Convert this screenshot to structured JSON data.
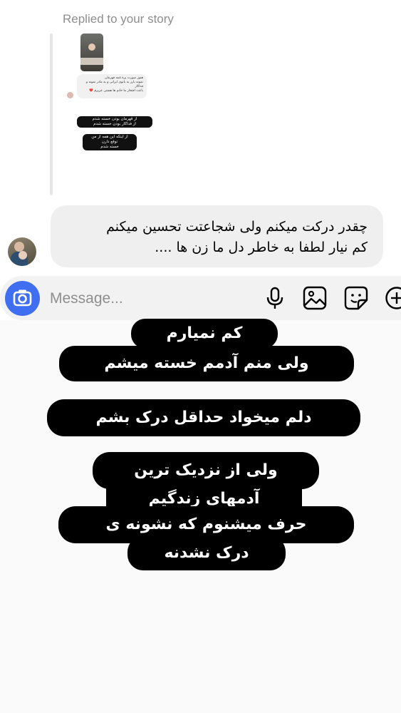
{
  "dm": {
    "replied_label": "Replied to your story",
    "story": {
      "caption_lines": [
        "هنوز صورت پره غمه قهرمان",
        "نمونه بارز به بانوی ایرانی و یه مادر نمونه و فداکار",
        "باعث افتخار ما خانم ها هستی عزیزم ❤️"
      ],
      "mini_pill_1": [
        "از قهرمان بودن خسته شدم",
        "از فداکار بودن خسته شدم"
      ],
      "mini_pill_2": [
        "از اینکه این همه از من",
        "توقع دارن",
        "خسته شدم"
      ]
    },
    "message_lines": [
      "چقدر درکت میکنم ولی شجاعتت تحسین میکنم",
      "کم نیار لطفا به خاطر دل ما زن ها ...."
    ]
  },
  "composer": {
    "placeholder": "Message...",
    "accent_color": "#3f6ff0",
    "icons": [
      "camera-icon",
      "microphone-icon",
      "gallery-icon",
      "sticker-icon",
      "plus-icon"
    ]
  },
  "story_text": {
    "block1": [
      "کم نمیارم",
      "ولی منم آدمم خسته میشم"
    ],
    "block2": [
      "دلم میخواد حداقل درک بشم"
    ],
    "block3": [
      "ولی از نزدیک ترین",
      "آدمهای زندگیم",
      "حرف میشنوم که نشونه ی",
      "درک نشدنه"
    ]
  }
}
